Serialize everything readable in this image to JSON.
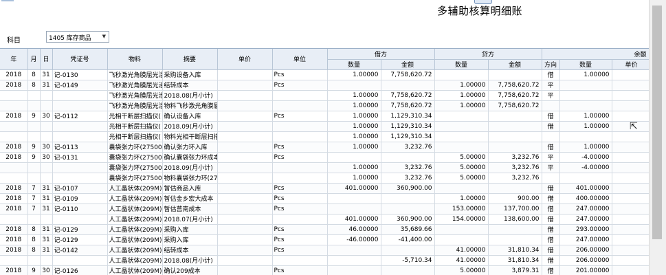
{
  "report": {
    "title": "多辅助核算明细账"
  },
  "filter": {
    "subject_label": "科目",
    "subject_value": "1405 库存商品"
  },
  "columns": {
    "year": "年",
    "month": "月",
    "day": "日",
    "voucher": "凭证号",
    "material": "物料",
    "summary": "摘要",
    "price": "单价",
    "unit": "单位",
    "debit": "借方",
    "credit": "贷方",
    "balance": "余额",
    "qty": "数量",
    "amount": "金额",
    "direction": "方向",
    "unit_price": "单价"
  },
  "rows": [
    {
      "y": "2018",
      "m": "8",
      "d": "31",
      "v": "记-0130",
      "mat": "飞秒激光角膜屈光治",
      "sum": "采购设备入库",
      "price": "",
      "unit": "Pcs",
      "dq": "1.00000",
      "da": "7,758,620.72",
      "cq": "",
      "ca": "",
      "dir": "借",
      "bq": "1.00000",
      "bp": ""
    },
    {
      "y": "2018",
      "m": "8",
      "d": "31",
      "v": "记-0149",
      "mat": "飞秒激光角膜屈光治",
      "sum": "结转成本",
      "price": "",
      "unit": "Pcs",
      "dq": "",
      "da": "",
      "cq": "1.00000",
      "ca": "7,758,620.72",
      "dir": "平",
      "bq": "",
      "bp": ""
    },
    {
      "y": "",
      "m": "",
      "d": "",
      "v": "",
      "mat": "飞秒激光角膜屈光治",
      "sum": "2018.08(月小计)",
      "price": "",
      "unit": "",
      "dq": "1.00000",
      "da": "7,758,620.72",
      "cq": "1.00000",
      "ca": "7,758,620.72",
      "dir": "平",
      "bq": "",
      "bp": ""
    },
    {
      "y": "",
      "m": "",
      "d": "",
      "v": "",
      "mat": "飞秒激光角膜屈光治",
      "sum": "物料飞秒激光角膜屈",
      "price": "",
      "unit": "",
      "dq": "1.00000",
      "da": "7,758,620.72",
      "cq": "1.00000",
      "ca": "7,758,620.72",
      "dir": "",
      "bq": "",
      "bp": ""
    },
    {
      "y": "2018",
      "m": "9",
      "d": "30",
      "v": "记-0112",
      "mat": "光相干断层扫描仪(",
      "sum": "确认设备入库",
      "price": "",
      "unit": "Pcs",
      "dq": "1.00000",
      "da": "1,129,310.34",
      "cq": "",
      "ca": "",
      "dir": "借",
      "bq": "1.00000",
      "bp": ""
    },
    {
      "y": "",
      "m": "",
      "d": "",
      "v": "",
      "mat": "光相干断层扫描仪(",
      "sum": "2018.09(月小计)",
      "price": "",
      "unit": "",
      "dq": "1.00000",
      "da": "1,129,310.34",
      "cq": "",
      "ca": "",
      "dir": "借",
      "bq": "1.00000",
      "bp": ""
    },
    {
      "y": "",
      "m": "",
      "d": "",
      "v": "",
      "mat": "光相干断层扫描仪(",
      "sum": "物料光相干断层扫描",
      "price": "",
      "unit": "",
      "dq": "1.00000",
      "da": "1,129,310.34",
      "cq": "",
      "ca": "",
      "dir": "",
      "bq": "",
      "bp": ""
    },
    {
      "y": "2018",
      "m": "9",
      "d": "30",
      "v": "记-0113",
      "mat": "囊袋张力环(27500",
      "sum": "确认张力环入库",
      "price": "",
      "unit": "Pcs",
      "dq": "1.00000",
      "da": "3,232.76",
      "cq": "",
      "ca": "",
      "dir": "借",
      "bq": "1.00000",
      "bp": ""
    },
    {
      "y": "2018",
      "m": "9",
      "d": "30",
      "v": "记-0131",
      "mat": "囊袋张力环(27500",
      "sum": "确认囊袋张力环成本",
      "price": "",
      "unit": "Pcs",
      "dq": "",
      "da": "",
      "cq": "5.00000",
      "ca": "3,232.76",
      "dir": "平",
      "bq": "-4.00000",
      "bp": ""
    },
    {
      "y": "",
      "m": "",
      "d": "",
      "v": "",
      "mat": "囊袋张力环(27500",
      "sum": "2018.09(月小计)",
      "price": "",
      "unit": "",
      "dq": "1.00000",
      "da": "3,232.76",
      "cq": "5.00000",
      "ca": "3,232.76",
      "dir": "平",
      "bq": "-4.00000",
      "bp": ""
    },
    {
      "y": "",
      "m": "",
      "d": "",
      "v": "",
      "mat": "囊袋张力环(27500",
      "sum": "物料囊袋张力环(27",
      "price": "",
      "unit": "",
      "dq": "1.00000",
      "da": "3,232.76",
      "cq": "5.00000",
      "ca": "3,232.76",
      "dir": "",
      "bq": "",
      "bp": ""
    },
    {
      "y": "2018",
      "m": "7",
      "d": "31",
      "v": "记-0107",
      "mat": "人工晶状体(209M)",
      "sum": "暂估商品入库",
      "price": "",
      "unit": "Pcs",
      "dq": "401.00000",
      "da": "360,900.00",
      "cq": "",
      "ca": "",
      "dir": "借",
      "bq": "401.00000",
      "bp": ""
    },
    {
      "y": "2018",
      "m": "7",
      "d": "31",
      "v": "记-0109",
      "mat": "人工晶状体(209M)",
      "sum": "暂估金乡宏大成本",
      "price": "",
      "unit": "Pcs",
      "dq": "",
      "da": "",
      "cq": "1.00000",
      "ca": "900.00",
      "dir": "借",
      "bq": "400.00000",
      "bp": ""
    },
    {
      "y": "2018",
      "m": "7",
      "d": "31",
      "v": "记-0110",
      "mat": "人工晶状体(209M)",
      "sum": "暂估莒南成本",
      "price": "",
      "unit": "Pcs",
      "dq": "",
      "da": "",
      "cq": "153.00000",
      "ca": "137,700.00",
      "dir": "借",
      "bq": "247.00000",
      "bp": ""
    },
    {
      "y": "",
      "m": "",
      "d": "",
      "v": "",
      "mat": "人工晶状体(209M)",
      "sum": "2018.07(月小计)",
      "price": "",
      "unit": "",
      "dq": "401.00000",
      "da": "360,900.00",
      "cq": "154.00000",
      "ca": "138,600.00",
      "dir": "借",
      "bq": "247.00000",
      "bp": ""
    },
    {
      "y": "2018",
      "m": "8",
      "d": "31",
      "v": "记-0129",
      "mat": "人工晶状体(209M)",
      "sum": "采购入库",
      "price": "",
      "unit": "Pcs",
      "dq": "46.00000",
      "da": "35,689.66",
      "cq": "",
      "ca": "",
      "dir": "借",
      "bq": "293.00000",
      "bp": ""
    },
    {
      "y": "2018",
      "m": "8",
      "d": "31",
      "v": "记-0129",
      "mat": "人工晶状体(209M)",
      "sum": "采购入库",
      "price": "",
      "unit": "Pcs",
      "dq": "-46.00000",
      "da": "-41,400.00",
      "cq": "",
      "ca": "",
      "dir": "借",
      "bq": "247.00000",
      "bp": ""
    },
    {
      "y": "2018",
      "m": "8",
      "d": "31",
      "v": "记-0142",
      "mat": "人工晶状体(209M)",
      "sum": "结转成本",
      "price": "",
      "unit": "Pcs",
      "dq": "",
      "da": "",
      "cq": "41.00000",
      "ca": "31,810.34",
      "dir": "借",
      "bq": "206.00000",
      "bp": ""
    },
    {
      "y": "",
      "m": "",
      "d": "",
      "v": "",
      "mat": "人工晶状体(209M)",
      "sum": "2018.08(月小计)",
      "price": "",
      "unit": "",
      "dq": "",
      "da": "-5,710.34",
      "cq": "41.00000",
      "ca": "31,810.34",
      "dir": "借",
      "bq": "206.00000",
      "bp": ""
    },
    {
      "y": "2018",
      "m": "9",
      "d": "30",
      "v": "记-0126",
      "mat": "人工晶状体(209M)",
      "sum": "确认209成本",
      "price": "",
      "unit": "Pcs",
      "dq": "",
      "da": "",
      "cq": "5.00000",
      "ca": "3,879.31",
      "dir": "借",
      "bq": "201.00000",
      "bp": ""
    }
  ]
}
